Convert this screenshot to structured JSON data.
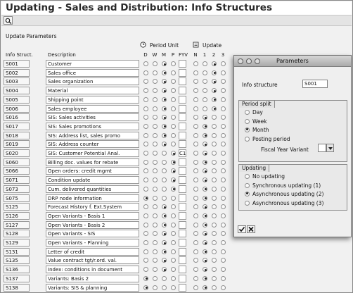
{
  "app": {
    "title": "Updating - Sales and Distribution: Info Structures"
  },
  "toolbar": {
    "search_icon": "magnifier-icon"
  },
  "main": {
    "section_title": "Update Parameters",
    "group_period_unit": "Period Unit",
    "group_update": "Update",
    "headers": {
      "info_struct": "Info Struct.",
      "description": "Description",
      "d": "D",
      "w": "W",
      "m": "M",
      "p": "P",
      "fyv": "FYV",
      "n": "N",
      "u1": "1",
      "u2": "2",
      "u3": "3"
    },
    "rows": [
      {
        "code": "S001",
        "desc": "Customer",
        "period": "M",
        "fyv": "",
        "update": "2"
      },
      {
        "code": "S002",
        "desc": "Sales office",
        "period": "M",
        "fyv": "",
        "update": "2"
      },
      {
        "code": "S003",
        "desc": "Sales organization",
        "period": "M",
        "fyv": "",
        "update": "2"
      },
      {
        "code": "S004",
        "desc": "Material",
        "period": "M",
        "fyv": "",
        "update": "2"
      },
      {
        "code": "S005",
        "desc": "Shipping point",
        "period": "M",
        "fyv": "",
        "update": "2"
      },
      {
        "code": "S006",
        "desc": "Sales employee",
        "period": "M",
        "fyv": "",
        "update": "2"
      },
      {
        "code": "S016",
        "desc": "SIS: Sales activities",
        "period": "M",
        "fyv": "",
        "update": "1"
      },
      {
        "code": "S017",
        "desc": "SIS: Sales promotions",
        "period": "M",
        "fyv": "",
        "update": "1"
      },
      {
        "code": "S018",
        "desc": "SIS: Address list, sales promo",
        "period": "M",
        "fyv": "",
        "update": "1"
      },
      {
        "code": "S019",
        "desc": "SIS: Address counter",
        "period": "M",
        "fyv": "",
        "update": "1"
      },
      {
        "code": "S020",
        "desc": "SIS: Customer Potential Anal.",
        "period": "P",
        "fyv": "C1",
        "update": "1"
      },
      {
        "code": "S060",
        "desc": "Billing doc. values for rebate",
        "period": "P",
        "fyv": "",
        "update": "1"
      },
      {
        "code": "S066",
        "desc": "Open orders: credit mgmt",
        "period": "P",
        "fyv": "",
        "update": "1"
      },
      {
        "code": "S071",
        "desc": "Condition update",
        "period": "P",
        "fyv": "",
        "update": "1"
      },
      {
        "code": "S073",
        "desc": "Cum. delivered quantities",
        "period": "P",
        "fyv": "",
        "update": "1"
      },
      {
        "code": "S075",
        "desc": "DRP node information",
        "period": "D",
        "fyv": "",
        "update": "1"
      },
      {
        "code": "S125",
        "desc": "Forecast History f. Ext.System",
        "period": "M",
        "fyv": "",
        "update": "1"
      },
      {
        "code": "S126",
        "desc": "Open Variants - Basis 1",
        "period": "M",
        "fyv": "",
        "update": "1"
      },
      {
        "code": "S127",
        "desc": "Open Variants - Basis 2",
        "period": "M",
        "fyv": "",
        "update": "1"
      },
      {
        "code": "S128",
        "desc": "Open Variants - SIS",
        "period": "M",
        "fyv": "",
        "update": "1"
      },
      {
        "code": "S129",
        "desc": "Open Variants - Planning",
        "period": "M",
        "fyv": "",
        "update": "1"
      },
      {
        "code": "S131",
        "desc": "Letter of credit",
        "period": "M",
        "fyv": "",
        "update": "1"
      },
      {
        "code": "S135",
        "desc": "Value contract tgt/r.ord. val.",
        "period": "M",
        "fyv": "",
        "update": "1"
      },
      {
        "code": "S136",
        "desc": "Index: conditions in document",
        "period": "M",
        "fyv": "",
        "update": "1"
      },
      {
        "code": "S137",
        "desc": "Variants: Basis 2",
        "period": "D",
        "fyv": "",
        "update": "1"
      },
      {
        "code": "S138",
        "desc": "Variants: SIS & planning",
        "period": "D",
        "fyv": "",
        "update": "1"
      }
    ]
  },
  "dialog": {
    "title": "Parameters",
    "info_structure_label": "Info structure",
    "info_structure_value": "S001",
    "period_split_title": "Period split",
    "period_options": [
      "Day",
      "Week",
      "Month",
      "Posting period"
    ],
    "period_selected": 2,
    "fiscal_year_variant_label": "Fiscal Year Variant",
    "updating_title": "Updating",
    "updating_options": [
      "No updating",
      "Synchronous updating (1)",
      "Asynchronous updating (2)",
      "Asynchronous updating (3)"
    ],
    "updating_selected": 2,
    "ok_icon": "checkmark-icon",
    "cancel_icon": "cancel-icon"
  }
}
